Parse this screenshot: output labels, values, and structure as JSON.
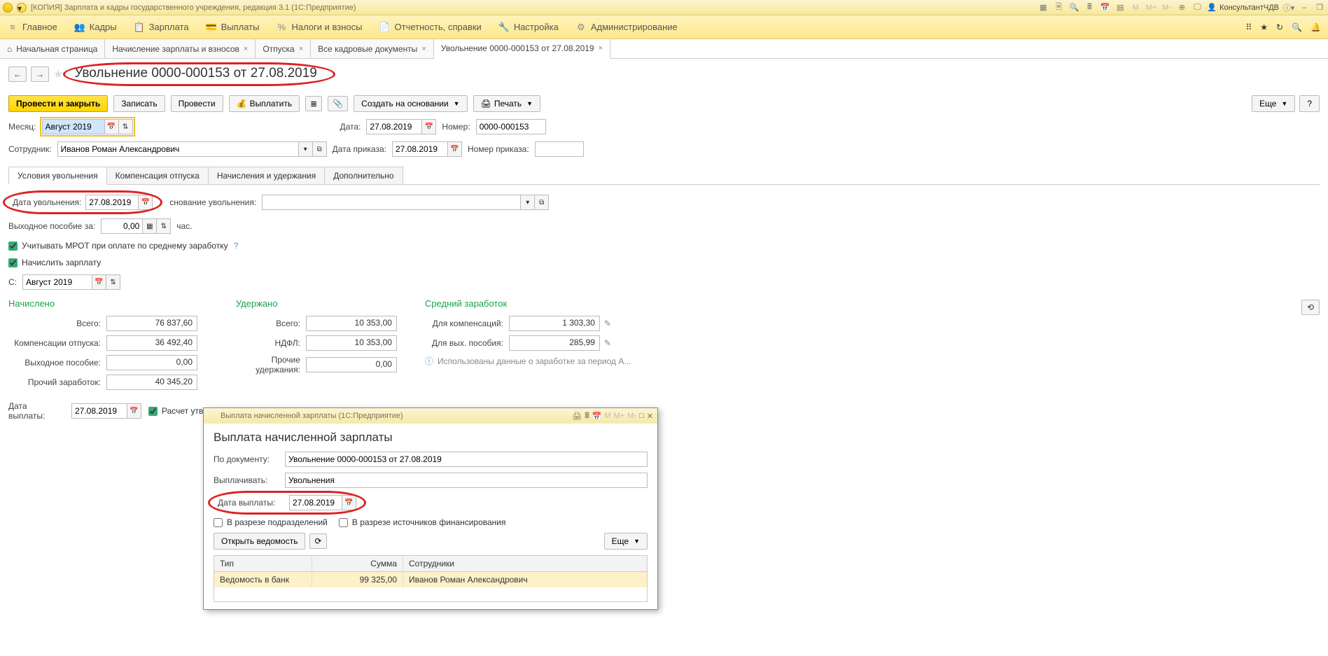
{
  "app": {
    "title": "[КОПИЯ] Зарплата и кадры государственного учреждения, редакция 3.1  (1С:Предприятие)",
    "user": "КонсультантЧДВ"
  },
  "main_menu": [
    {
      "icon": "≡",
      "label": "Главное"
    },
    {
      "icon": "👥",
      "label": "Кадры"
    },
    {
      "icon": "📋",
      "label": "Зарплата"
    },
    {
      "icon": "💳",
      "label": "Выплаты"
    },
    {
      "icon": "%",
      "label": "Налоги и взносы"
    },
    {
      "icon": "📄",
      "label": "Отчетность, справки"
    },
    {
      "icon": "🔧",
      "label": "Настройка"
    },
    {
      "icon": "⚙",
      "label": "Администрирование"
    }
  ],
  "tabs": [
    {
      "label": "Начальная страница",
      "closable": false,
      "home": true
    },
    {
      "label": "Начисление зарплаты и взносов",
      "closable": true
    },
    {
      "label": "Отпуска",
      "closable": true
    },
    {
      "label": "Все кадровые документы",
      "closable": true
    },
    {
      "label": "Увольнение 0000-000153 от 27.08.2019",
      "closable": true,
      "active": true
    }
  ],
  "page": {
    "title": "Увольнение 0000-000153 от 27.08.2019",
    "toolbar": {
      "save_close": "Провести и закрыть",
      "save": "Записать",
      "post": "Провести",
      "pay": "Выплатить",
      "create_based": "Создать на основании",
      "print": "Печать",
      "more": "Еще",
      "help": "?"
    },
    "month_label": "Месяц:",
    "month": "Август 2019",
    "date_label": "Дата:",
    "date": "27.08.2019",
    "number_label": "Номер:",
    "number": "0000-000153",
    "employee_label": "Сотрудник:",
    "employee": "Иванов Роман Александрович",
    "order_date_label": "Дата приказа:",
    "order_date": "27.08.2019",
    "order_num_label": "Номер приказа:",
    "order_num": ""
  },
  "sub_tabs": [
    "Условия увольнения",
    "Компенсация отпуска",
    "Начисления и удержания",
    "Дополнительно"
  ],
  "fire": {
    "date_label": "Дата увольнения:",
    "date": "27.08.2019",
    "reason_label": "снование увольнения:",
    "severance_label": "Выходное пособие за:",
    "severance_value": "0,00",
    "severance_unit": "час.",
    "mrot": "Учитывать МРОТ при оплате по среднему заработку",
    "accrue": "Начислить зарплату",
    "from_label": "С:",
    "from": "Август 2019"
  },
  "totals": {
    "accrued_head": "Начислено",
    "withheld_head": "Удержано",
    "avg_head": "Средний заработок",
    "rows_a": [
      {
        "l": "Всего:",
        "v": "76 837,60"
      },
      {
        "l": "Компенсации отпуска:",
        "v": "36 492,40"
      },
      {
        "l": "Выходное пособие:",
        "v": "0,00"
      },
      {
        "l": "Прочий заработок:",
        "v": "40 345,20"
      }
    ],
    "rows_w": [
      {
        "l": "Всего:",
        "v": "10 353,00"
      },
      {
        "l": "НДФЛ:",
        "v": "10 353,00"
      },
      {
        "l": "Прочие удержания:",
        "v": "0,00"
      }
    ],
    "rows_avg": [
      {
        "l": "Для компенсаций:",
        "v": "1 303,30"
      },
      {
        "l": "Для вых. пособия:",
        "v": "285,99"
      }
    ],
    "info": "Использованы данные о заработке за период А...",
    "paydate_label": "Дата выплаты:",
    "paydate": "27.08.2019",
    "calc_approved": "Расчет утве"
  },
  "dialog": {
    "window_title": "Выплата начисленной зарплаты  (1С:Предприятие)",
    "heading": "Выплата начисленной зарплаты",
    "by_doc_label": "По документу:",
    "by_doc": "Увольнение 0000-000153 от 27.08.2019",
    "pay_label": "Выплачивать:",
    "pay": "Увольнения",
    "paydate_label": "Дата выплаты:",
    "paydate": "27.08.2019",
    "split_dept": "В разрезе подразделений",
    "split_src": "В разрезе источников финансирования",
    "open": "Открыть ведомость",
    "more": "Еще",
    "cols": [
      "Тип",
      "Сумма",
      "Сотрудники"
    ],
    "row": {
      "type": "Ведомость в банк",
      "sum": "99 325,00",
      "emp": "Иванов Роман Александрович"
    }
  }
}
